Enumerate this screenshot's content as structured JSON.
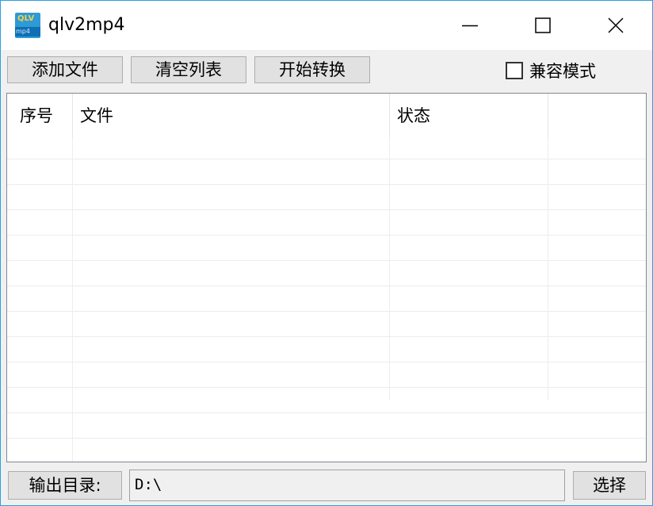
{
  "window": {
    "title": "qlv2mp4",
    "icon": {
      "name": "app-icon",
      "top_text": "QLV",
      "bottom_text": "mp4"
    },
    "controls": {
      "minimize_icon": "minimize-icon",
      "maximize_icon": "maximize-icon",
      "close_icon": "close-icon"
    }
  },
  "toolbar": {
    "add_files": "添加文件",
    "clear_list": "清空列表",
    "start_convert": "开始转换",
    "compat_mode_label": "兼容模式",
    "compat_mode_checked": false
  },
  "list": {
    "columns": [
      "序号",
      "文件",
      "状态",
      ""
    ],
    "rows": []
  },
  "output": {
    "label": "输出目录:",
    "path": "D:\\",
    "select_button": "选择"
  },
  "colors": {
    "window_border": "#2b9fe0",
    "button_face": "#e1e1e1",
    "background": "#f0f0f0"
  }
}
